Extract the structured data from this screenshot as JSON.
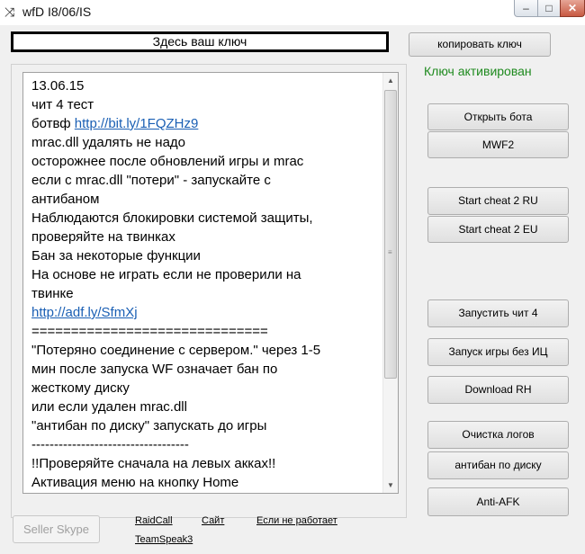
{
  "window": {
    "title": "wfD I8/06/IS",
    "minimize": "–",
    "maximize": "□",
    "close": "✕"
  },
  "key_box": {
    "text": "Здесь ваш ключ"
  },
  "copy_key_button": "копировать ключ",
  "status_text": "Ключ активирован",
  "notes": {
    "lines": [
      {
        "text": "13.06.15"
      },
      {
        "text": "чит 4 тест"
      },
      {
        "text": "ботвф ",
        "link": "http://bit.ly/1FQZHz9"
      },
      {
        "text": "mrac.dll удалять не надо"
      },
      {
        "text": "осторожнее после обновлений игры и mrac"
      },
      {
        "text": "если с mrac.dll \"потери\" - запускайте с"
      },
      {
        "text": "антибаном"
      },
      {
        "text": "Наблюдаются блокировки системой защиты,"
      },
      {
        "text": "проверяйте на твинках"
      },
      {
        "text": "Бан за некоторые функции"
      },
      {
        "text": "На основе не играть если не проверили на"
      },
      {
        "text": "твинке"
      },
      {
        "text": "",
        "link": "http://adf.ly/SfmXj"
      },
      {
        "text": "=============================="
      },
      {
        "text": "\"Потеряно соединение с сервером.\" через 1-5"
      },
      {
        "text": "мин после запуска WF означает бан по"
      },
      {
        "text": "жесткому диску"
      },
      {
        "text": "или если удален mrac.dll"
      },
      {
        "text": "\"антибан по диску\" запускать до игры"
      },
      {
        "text": "-----------------------------------"
      },
      {
        "text": "!!Проверяйте сначала на левых акках!!"
      },
      {
        "text": "Активация меню на кнопку Home"
      }
    ]
  },
  "buttons": {
    "open_bot": "Открыть бота",
    "mwf2": "MWF2",
    "start_ru": "Start cheat 2 RU",
    "start_eu": "Start cheat 2 EU",
    "run_cheat4": "Запустить чит 4",
    "launch_no_ic": "Запуск игры без ИЦ",
    "download_rh": "Download RH",
    "clear_logs": "Очистка логов",
    "disk_antiban": "антибан по диску",
    "anti_afk": "Anti-AFK"
  },
  "footer": {
    "seller_skype": "Seller Skype",
    "raidcall": "RaidCall",
    "site": "Сайт",
    "if_not_working": "Если не работает",
    "teamspeak": "TeamSpeak3"
  }
}
